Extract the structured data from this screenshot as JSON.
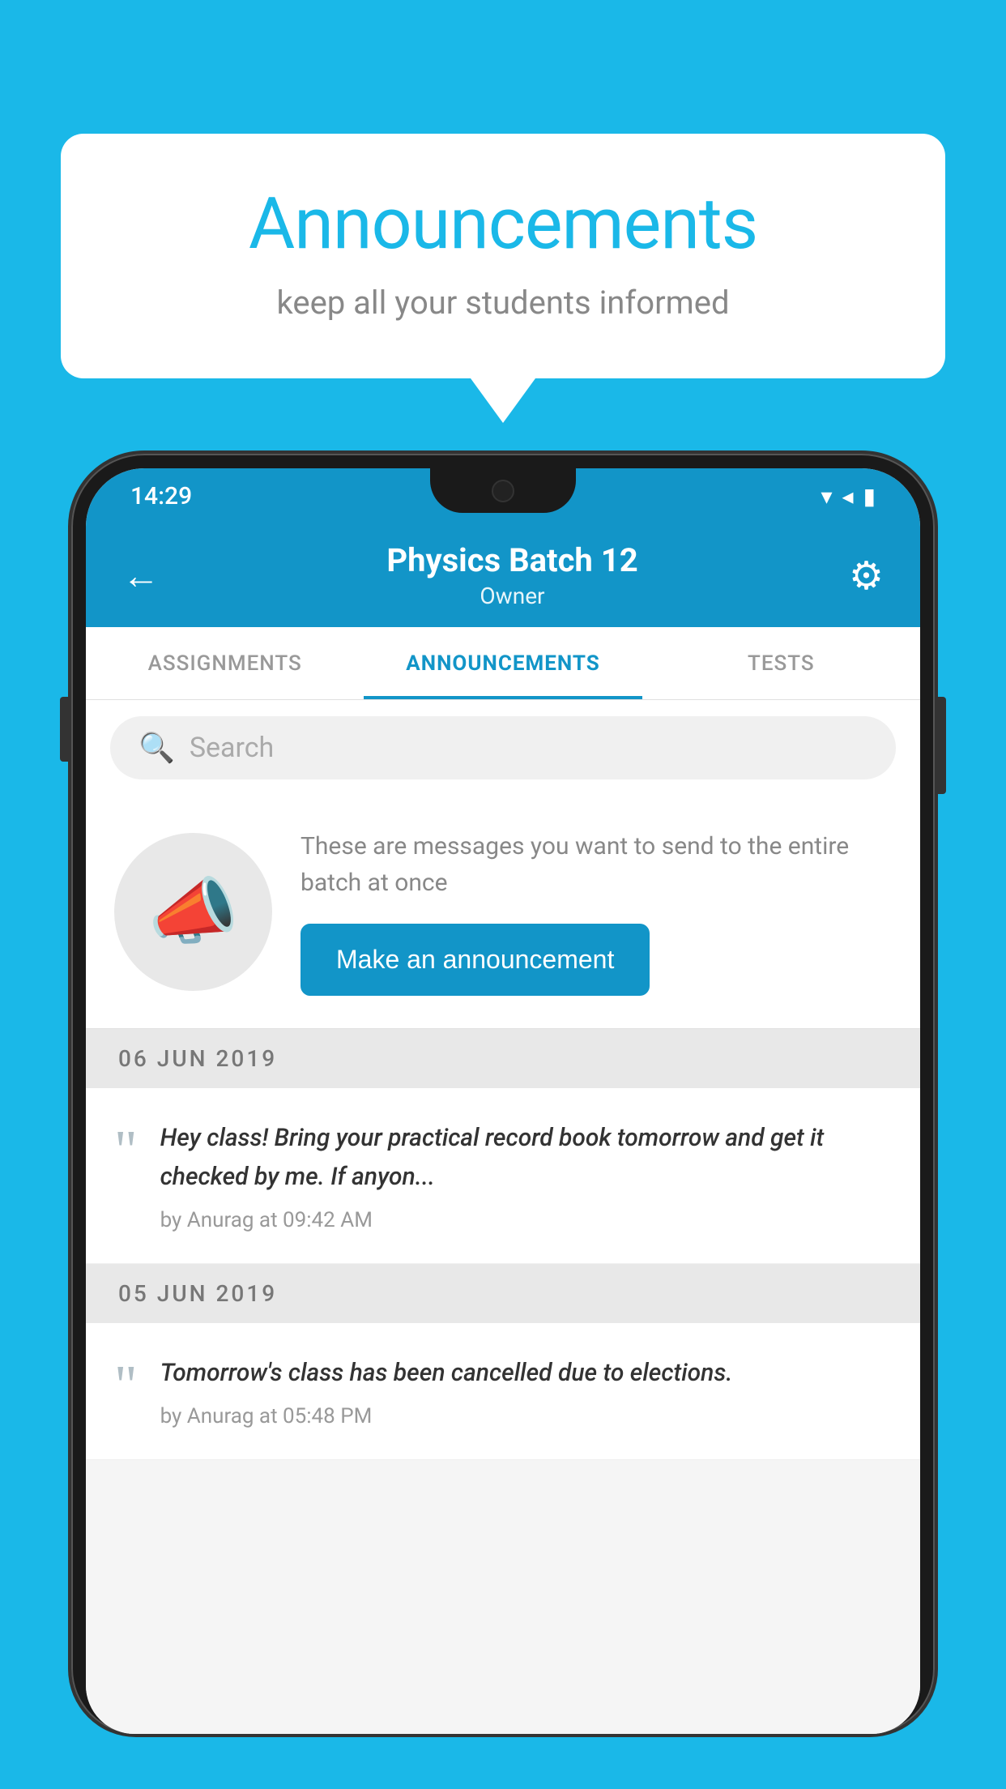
{
  "background_color": "#1ab8e8",
  "speech_bubble": {
    "title": "Announcements",
    "subtitle": "keep all your students informed"
  },
  "phone": {
    "status_bar": {
      "time": "14:29",
      "icons": [
        "wifi",
        "signal",
        "battery"
      ]
    },
    "app_bar": {
      "title": "Physics Batch 12",
      "subtitle": "Owner",
      "back_label": "←",
      "settings_label": "⚙"
    },
    "tabs": [
      {
        "label": "ASSIGNMENTS",
        "active": false
      },
      {
        "label": "ANNOUNCEMENTS",
        "active": true
      },
      {
        "label": "TESTS",
        "active": false
      }
    ],
    "search": {
      "placeholder": "Search"
    },
    "promo": {
      "description": "These are messages you want to send to the entire batch at once",
      "button_label": "Make an announcement"
    },
    "announcements": [
      {
        "date": "06  JUN  2019",
        "items": [
          {
            "text": "Hey class! Bring your practical record book tomorrow and get it checked by me. If anyon...",
            "meta": "by Anurag at 09:42 AM"
          }
        ]
      },
      {
        "date": "05  JUN  2019",
        "items": [
          {
            "text": "Tomorrow's class has been cancelled due to elections.",
            "meta": "by Anurag at 05:48 PM"
          }
        ]
      }
    ]
  }
}
